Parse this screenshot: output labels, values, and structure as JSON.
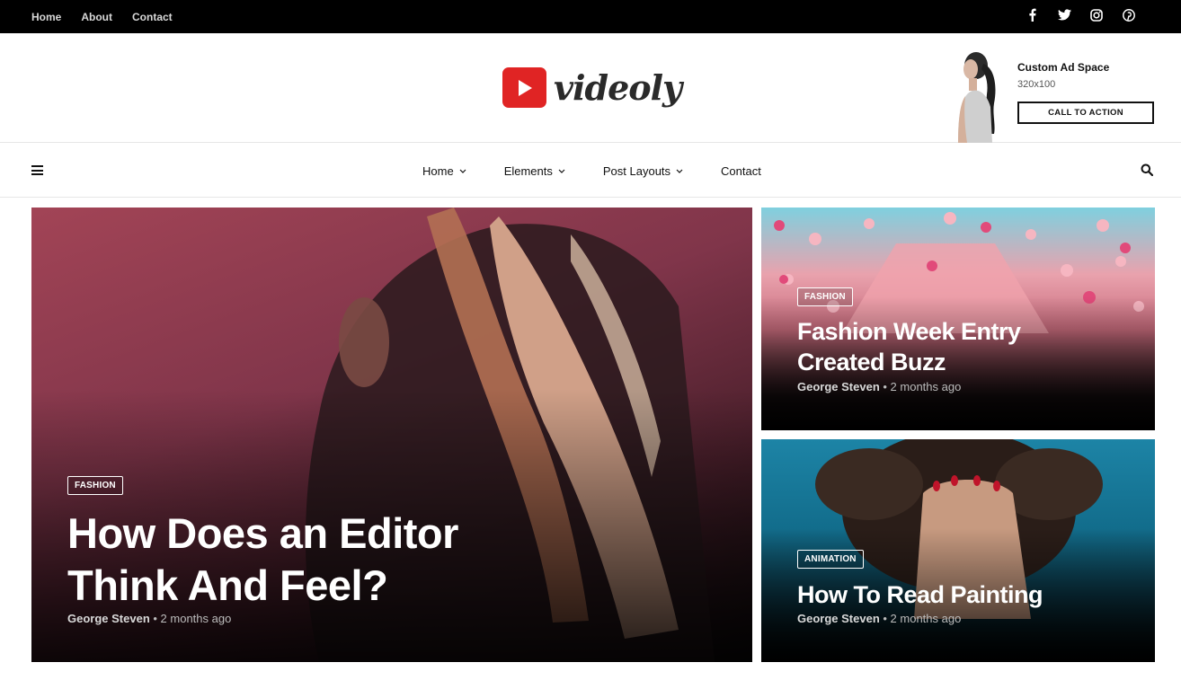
{
  "topbar": {
    "links": [
      "Home",
      "About",
      "Contact"
    ],
    "social": [
      "facebook-icon",
      "twitter-icon",
      "instagram-icon",
      "pinterest-icon"
    ]
  },
  "header": {
    "logo_text": "videoly",
    "ad": {
      "title": "Custom Ad Space",
      "size": "320x100",
      "cta": "CALL TO ACTION"
    }
  },
  "nav": {
    "items": [
      {
        "label": "Home",
        "dropdown": true
      },
      {
        "label": "Elements",
        "dropdown": true
      },
      {
        "label": "Post Layouts",
        "dropdown": true
      },
      {
        "label": "Contact",
        "dropdown": false
      }
    ]
  },
  "posts": {
    "main": {
      "category": "FASHION",
      "title_line1": "How Does an Editor",
      "title_line2": "Think And Feel?",
      "author": "George Steven",
      "date": "2 months ago"
    },
    "top": {
      "category": "FASHION",
      "title_line1": "Fashion Week Entry",
      "title_line2": "Created Buzz",
      "author": "George Steven",
      "date": "2 months ago"
    },
    "bottom": {
      "category": "ANIMATION",
      "title_line1": "How To Read Painting",
      "author": "George Steven",
      "date": "2 months ago"
    }
  },
  "colors": {
    "brand_red": "#e02424",
    "topbar_bg": "#000000"
  }
}
